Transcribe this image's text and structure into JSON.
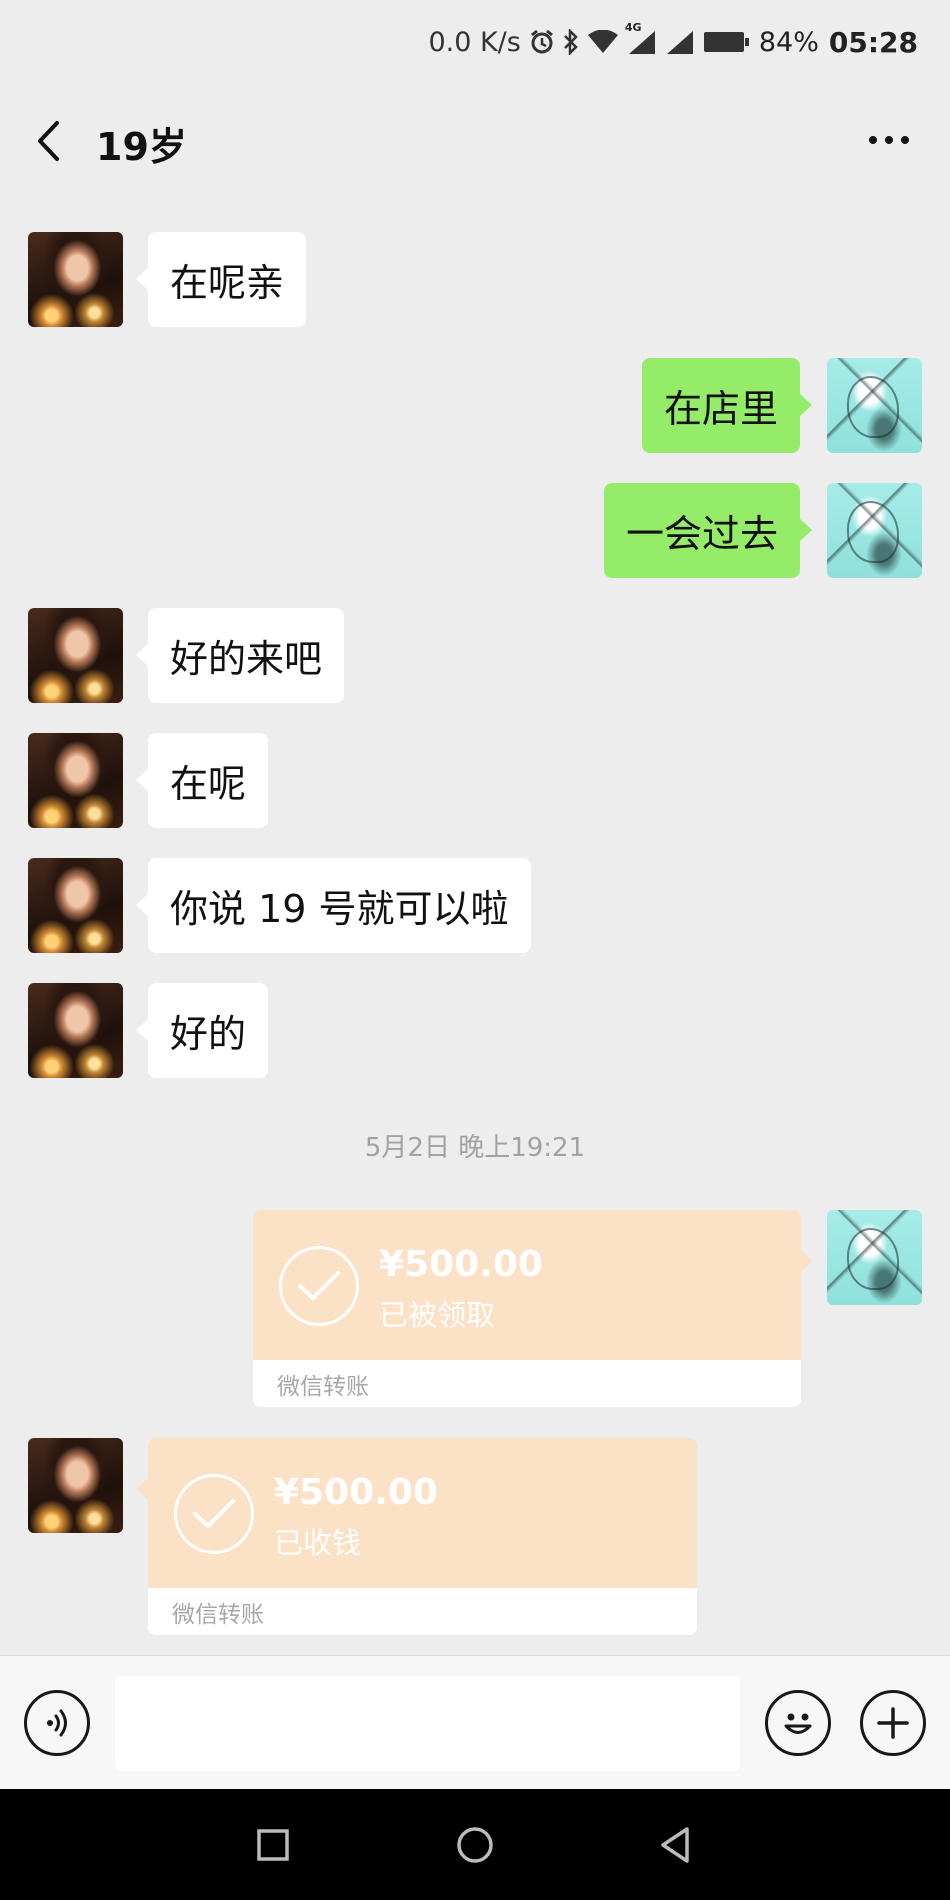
{
  "status_bar": {
    "net_speed": "0.0 K/s",
    "network_type": "4G",
    "battery": "84%",
    "time": "05:28",
    "icons": [
      "alarm-icon",
      "bluetooth-icon",
      "wifi-icon",
      "signal-icon",
      "signal-icon",
      "battery-icon"
    ]
  },
  "header": {
    "title": "19岁",
    "back_icon": "back-chevron-icon",
    "more_icon": "more-dots-icon"
  },
  "messages": [
    {
      "side": "left",
      "text": "在呢亲"
    },
    {
      "side": "right",
      "text": "在店里"
    },
    {
      "side": "right",
      "text": "一会过去"
    },
    {
      "side": "left",
      "text": "好的来吧"
    },
    {
      "side": "left",
      "text": "在呢"
    },
    {
      "side": "left",
      "text": "你说 19 号就可以啦"
    },
    {
      "side": "left",
      "text": "好的"
    }
  ],
  "timestamp": "5月2日 晚上19:21",
  "transfers": [
    {
      "side": "right",
      "amount": "¥500.00",
      "status": "已被领取",
      "footer": "微信转账"
    },
    {
      "side": "left",
      "amount": "¥500.00",
      "status": "已收钱",
      "footer": "微信转账"
    }
  ],
  "input_bar": {
    "placeholder": "",
    "icons": [
      "voice-icon",
      "emoji-icon",
      "plus-icon"
    ]
  },
  "nav_bar": {
    "icons": [
      "recent-apps-icon",
      "home-icon",
      "back-triangle-icon"
    ]
  },
  "colors": {
    "background": "#ededed",
    "sent_bubble": "#95ec69",
    "received_bubble": "#ffffff",
    "transfer_card": "#fbe1c6"
  }
}
